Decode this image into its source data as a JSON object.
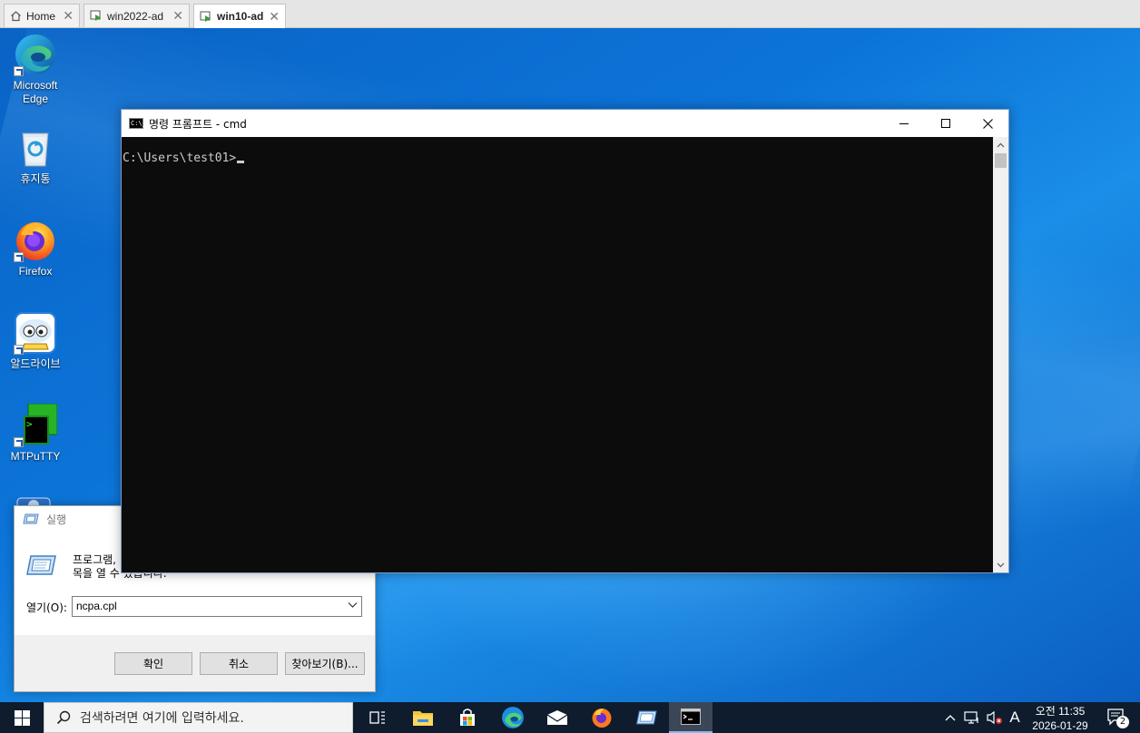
{
  "tabs": [
    {
      "label": "Home",
      "icon": "home-icon",
      "active": false
    },
    {
      "label": "win2022-ad",
      "icon": "vm-icon",
      "active": false
    },
    {
      "label": "win10-ad",
      "icon": "vm-icon",
      "active": true
    }
  ],
  "desktop_icons": [
    {
      "label": "Microsoft\nEdge",
      "line1": "Microsoft",
      "line2": "Edge",
      "icon": "edge-icon"
    },
    {
      "label": "휴지통",
      "icon": "recycle-bin-icon"
    },
    {
      "label": "Firefox",
      "icon": "firefox-icon"
    },
    {
      "label": "알드라이브",
      "icon": "aldrive-icon"
    },
    {
      "label": "MTPuTTY",
      "icon": "mtputty-icon"
    }
  ],
  "cmd": {
    "title": "명령 프롬프트 - cmd",
    "prompt": "C:\\Users\\test01>",
    "icon_text": "C:\\_"
  },
  "run_dialog": {
    "title": "실행",
    "description_line1": "프로그램,",
    "description_line2": "목을 열 수 있습니다.",
    "open_label": "열기(O):",
    "input_value": "ncpa.cpl",
    "ok_label": "확인",
    "cancel_label": "취소",
    "browse_label": "찾아보기(B)..."
  },
  "taskbar": {
    "search_placeholder": "검색하려면 여기에 입력하세요.",
    "apps": [
      "task-view-icon",
      "file-explorer-icon",
      "store-icon",
      "edge-icon",
      "mail-icon",
      "firefox-icon",
      "run-icon",
      "cmd-icon"
    ],
    "ime_label": "A",
    "clock_time": "오전 11:35",
    "clock_date": "2026-01-29",
    "notification_count": "2"
  },
  "colors": {
    "desktop_blue": "#0c74d8",
    "taskbar": "#0e1c2e",
    "console_bg": "#0c0c0c",
    "console_text": "#cccccc"
  }
}
